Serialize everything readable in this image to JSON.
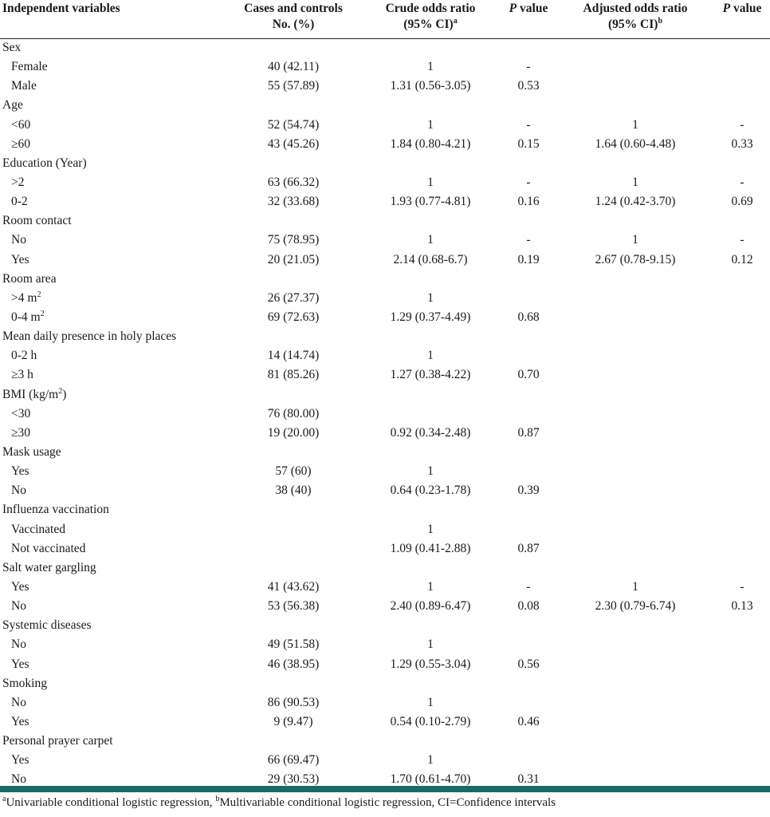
{
  "table": {
    "headers": {
      "independent": "Independent variables",
      "cases_1": "Cases and controls",
      "cases_2": "No. (%)",
      "crude_1": "Crude odds ratio",
      "crude_2": "(95% CI)",
      "crude_sup": "a",
      "p1_italic": "P",
      "p1_text": " value",
      "adj_1": "Adjusted odds ratio",
      "adj_2": "(95% CI)",
      "adj_sup": "b",
      "p2_italic": "P",
      "p2_text": " value"
    },
    "rows": [
      {
        "type": "group",
        "label": "Sex"
      },
      {
        "type": "sub",
        "label": "Female",
        "cases": "40 (42.11)",
        "crude": "1",
        "p1": "-",
        "adj": "",
        "p2": ""
      },
      {
        "type": "sub",
        "label": "Male",
        "cases": "55 (57.89)",
        "crude": "1.31 (0.56-3.05)",
        "p1": "0.53",
        "adj": "",
        "p2": ""
      },
      {
        "type": "group",
        "label": "Age"
      },
      {
        "type": "sub",
        "label": "<60",
        "cases": "52 (54.74)",
        "crude": "1",
        "p1": "-",
        "adj": "1",
        "p2": "-"
      },
      {
        "type": "sub",
        "label": "≥60",
        "cases": "43 (45.26)",
        "crude": "1.84 (0.80-4.21)",
        "p1": "0.15",
        "adj": "1.64 (0.60-4.48)",
        "p2": "0.33"
      },
      {
        "type": "group",
        "label": "Education (Year)"
      },
      {
        "type": "sub",
        "label": ">2",
        "cases": "63 (66.32)",
        "crude": "1",
        "p1": "-",
        "adj": "1",
        "p2": "-"
      },
      {
        "type": "sub",
        "label": "0-2",
        "cases": "32 (33.68)",
        "crude": "1.93 (0.77-4.81)",
        "p1": "0.16",
        "adj": "1.24 (0.42-3.70)",
        "p2": "0.69"
      },
      {
        "type": "group",
        "label": "Room contact"
      },
      {
        "type": "sub",
        "label": "No",
        "cases": "75 (78.95)",
        "crude": "1",
        "p1": "-",
        "adj": "1",
        "p2": "-"
      },
      {
        "type": "sub",
        "label": "Yes",
        "cases": "20 (21.05)",
        "crude": "2.14 (0.68-6.7)",
        "p1": "0.19",
        "adj": "2.67 (0.78-9.15)",
        "p2": "0.12"
      },
      {
        "type": "group",
        "label": "Room area"
      },
      {
        "type": "sub",
        "label": ">4 m",
        "sup": "2",
        "cases": "26 (27.37)",
        "crude": "1",
        "p1": "",
        "adj": "",
        "p2": ""
      },
      {
        "type": "sub",
        "label": "0-4 m",
        "sup": "2",
        "cases": "69 (72.63)",
        "crude": "1.29 (0.37-4.49)",
        "p1": "0.68",
        "adj": "",
        "p2": ""
      },
      {
        "type": "group",
        "label": "Mean daily presence in holy places"
      },
      {
        "type": "sub",
        "label": "0-2 h",
        "cases": "14 (14.74)",
        "crude": "1",
        "p1": "",
        "adj": "",
        "p2": ""
      },
      {
        "type": "sub",
        "label": "≥3 h",
        "cases": "81 (85.26)",
        "crude": "1.27 (0.38-4.22)",
        "p1": "0.70",
        "adj": "",
        "p2": ""
      },
      {
        "type": "group",
        "label": "BMI (kg/m",
        "sup": "2",
        "label_end": ")"
      },
      {
        "type": "sub",
        "label": "<30",
        "cases": "76 (80.00)",
        "crude": "",
        "p1": "",
        "adj": "",
        "p2": ""
      },
      {
        "type": "sub",
        "label": "≥30",
        "cases": "19 (20.00)",
        "crude": "0.92 (0.34-2.48)",
        "p1": "0.87",
        "adj": "",
        "p2": ""
      },
      {
        "type": "group",
        "label": "Mask usage"
      },
      {
        "type": "sub",
        "label": "Yes",
        "cases": "57 (60)",
        "crude": "1",
        "p1": "",
        "adj": "",
        "p2": ""
      },
      {
        "type": "sub",
        "label": "No",
        "cases": "38 (40)",
        "crude": "0.64 (0.23-1.78)",
        "p1": "0.39",
        "adj": "",
        "p2": ""
      },
      {
        "type": "group",
        "label": "Influenza vaccination"
      },
      {
        "type": "sub",
        "label": "Vaccinated",
        "cases": "",
        "crude": "1",
        "p1": "",
        "adj": "",
        "p2": ""
      },
      {
        "type": "sub",
        "label": "Not vaccinated",
        "cases": "",
        "crude": "1.09 (0.41-2.88)",
        "p1": "0.87",
        "adj": "",
        "p2": ""
      },
      {
        "type": "group",
        "label": "Salt water gargling"
      },
      {
        "type": "sub",
        "label": "Yes",
        "cases": "41 (43.62)",
        "crude": "1",
        "p1": "-",
        "adj": "1",
        "p2": "-"
      },
      {
        "type": "sub",
        "label": "No",
        "cases": "53 (56.38)",
        "crude": "2.40 (0.89-6.47)",
        "p1": "0.08",
        "adj": "2.30 (0.79-6.74)",
        "p2": "0.13"
      },
      {
        "type": "group",
        "label": "Systemic diseases"
      },
      {
        "type": "sub",
        "label": "No",
        "cases": "49 (51.58)",
        "crude": "1",
        "p1": "",
        "adj": "",
        "p2": ""
      },
      {
        "type": "sub",
        "label": "Yes",
        "cases": "46 (38.95)",
        "crude": "1.29 (0.55-3.04)",
        "p1": "0.56",
        "adj": "",
        "p2": ""
      },
      {
        "type": "group",
        "label": "Smoking"
      },
      {
        "type": "sub",
        "label": "No",
        "cases": "86 (90.53)",
        "crude": "1",
        "p1": "",
        "adj": "",
        "p2": ""
      },
      {
        "type": "sub",
        "label": "Yes",
        "cases": "9 (9.47)",
        "crude": "0.54 (0.10-2.79)",
        "p1": "0.46",
        "adj": "",
        "p2": ""
      },
      {
        "type": "group",
        "label": "Personal prayer carpet"
      },
      {
        "type": "sub",
        "label": "Yes",
        "cases": "66 (69.47)",
        "crude": "1",
        "p1": "",
        "adj": "",
        "p2": ""
      },
      {
        "type": "sub",
        "label": "No",
        "cases": "29 (30.53)",
        "crude": "1.70 (0.61-4.70)",
        "p1": "0.31",
        "adj": "",
        "p2": ""
      }
    ]
  },
  "footnote": {
    "sup_a": "a",
    "text_a": "Univariable conditional logistic regression, ",
    "sup_b": "b",
    "text_b": "Multivariable conditional logistic regression, CI=Confidence intervals"
  },
  "colors": {
    "rule": "#1a6b63",
    "text": "#1a1a1a"
  }
}
